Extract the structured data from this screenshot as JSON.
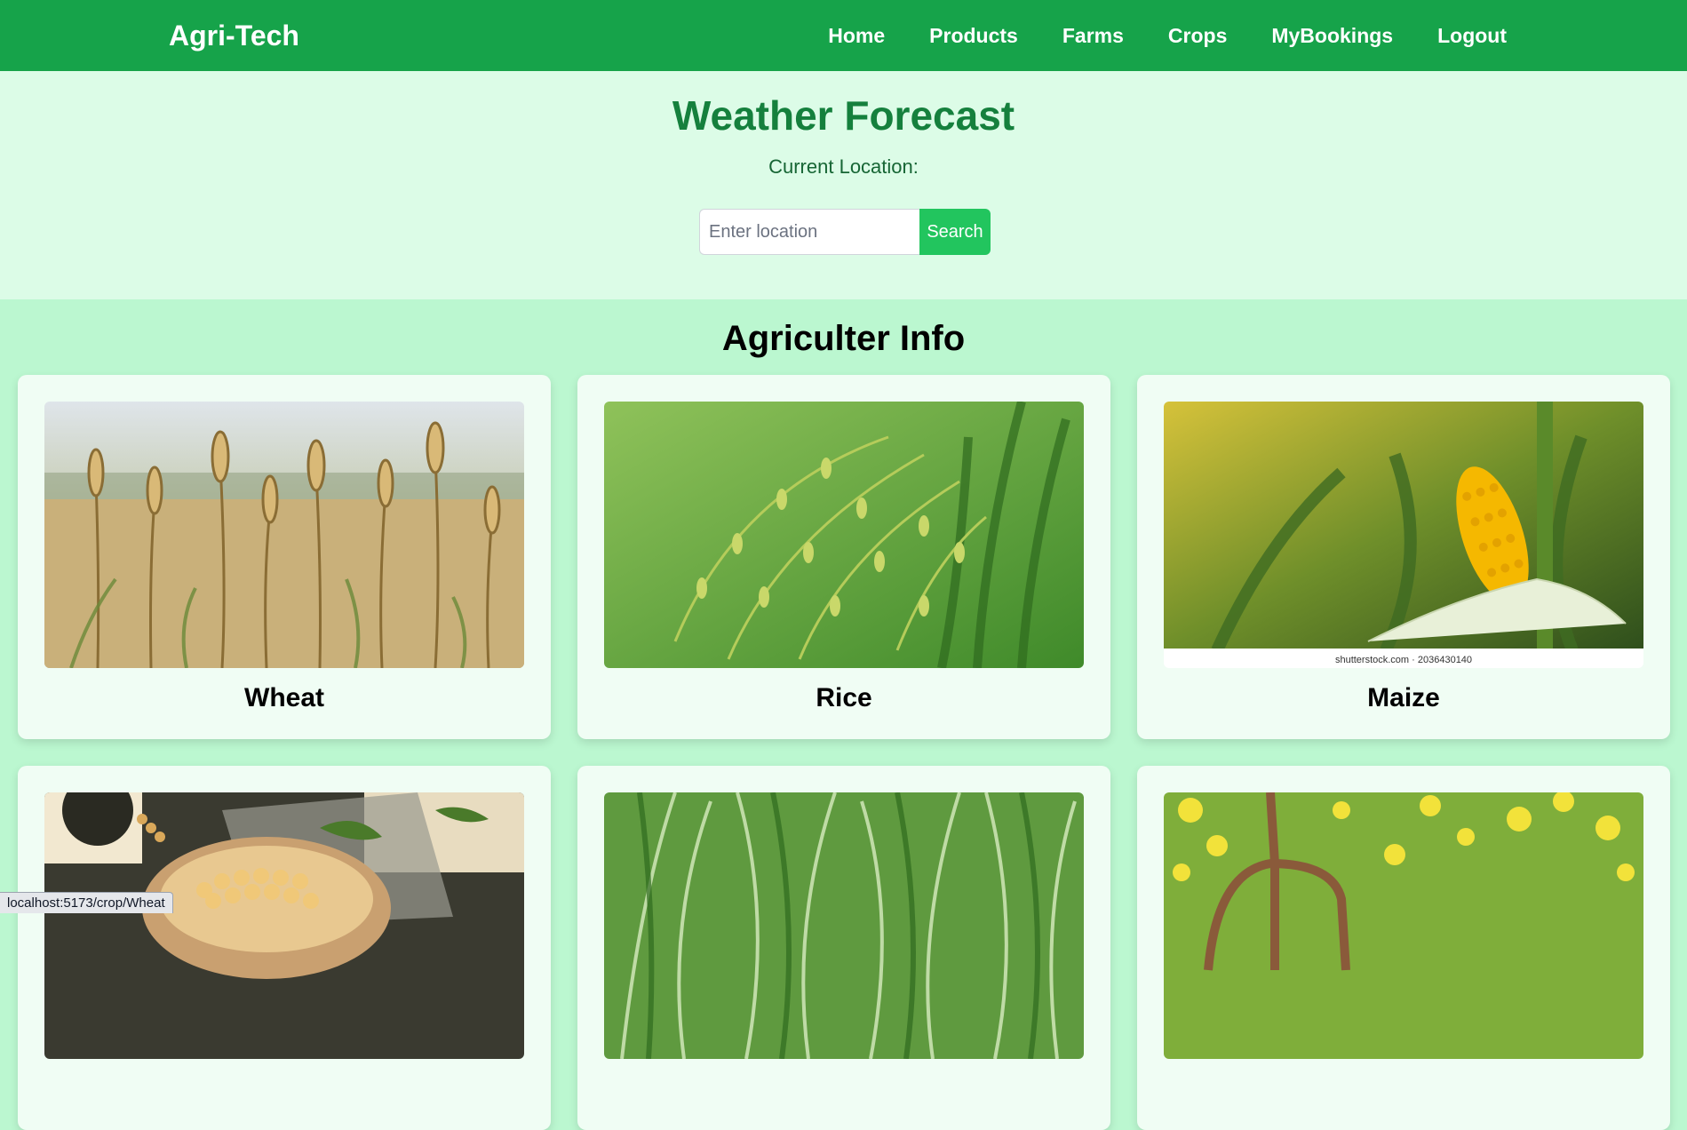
{
  "navbar": {
    "brand": "Agri-Tech",
    "links": [
      "Home",
      "Products",
      "Farms",
      "Crops",
      "MyBookings",
      "Logout"
    ]
  },
  "weather": {
    "title": "Weather Forecast",
    "location_label": "Current Location:",
    "search_placeholder": "Enter location",
    "search_value": "",
    "search_button": "Search"
  },
  "info": {
    "title": "Agriculter Info",
    "cards": [
      {
        "title": "Wheat",
        "image": "wheat-field-photo"
      },
      {
        "title": "Rice",
        "image": "rice-plant-photo"
      },
      {
        "title": "Maize",
        "image": "maize-corn-photo",
        "watermark": "shutterstock.com · 2036430140"
      },
      {
        "title": "",
        "image": "soybean-bowl-photo"
      },
      {
        "title": "",
        "image": "grass-crop-photo"
      },
      {
        "title": "",
        "image": "garden-fork-flowers-photo"
      }
    ]
  },
  "status_bar": {
    "url": "localhost:5173/crop/Wheat"
  },
  "colors": {
    "navbar": "#16a34a",
    "weather_bg": "#dcfce7",
    "page_bg": "#bbf7d0",
    "card_bg": "#f0fdf4",
    "title_green": "#15803d",
    "button": "#22c55e"
  }
}
